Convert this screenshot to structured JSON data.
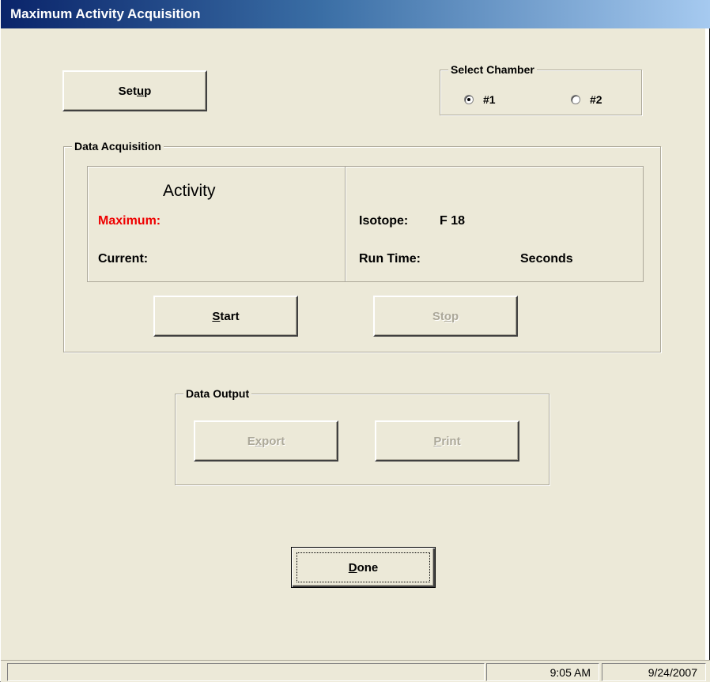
{
  "window": {
    "title": "Maximum Activity  Acquisition"
  },
  "setup_button": {
    "label_pre": "Set",
    "label_mnemonic": "u",
    "label_post": "p"
  },
  "select_chamber": {
    "label": "Select Chamber",
    "options": [
      {
        "label": "#1",
        "checked": true
      },
      {
        "label": "#2",
        "checked": false
      }
    ]
  },
  "data_acquisition": {
    "label": "Data Acquisition",
    "activity_heading": "Activity",
    "maximum_label": "Maximum:",
    "current_label": "Current:",
    "isotope_label": "Isotope:",
    "isotope_value": "F 18",
    "run_time_label": "Run Time:",
    "run_time_unit": "Seconds",
    "start_button": {
      "mnemonic": "S",
      "rest": "tart"
    },
    "stop_button": {
      "pre": "St",
      "mnemonic": "o",
      "post": "p",
      "enabled": false
    }
  },
  "data_output": {
    "label": "Data Output",
    "export_button": {
      "pre": "E",
      "mnemonic": "x",
      "post": "port",
      "enabled": false
    },
    "print_button": {
      "mnemonic": "P",
      "rest": "rint",
      "enabled": false
    }
  },
  "done_button": {
    "mnemonic": "D",
    "rest": "one"
  },
  "status_bar": {
    "message": "",
    "time": "9:05 AM",
    "date": "9/24/2007"
  },
  "colors": {
    "maximum_label": "#ee0000",
    "face": "#ece9d8",
    "disabled_text": "#aca899"
  }
}
